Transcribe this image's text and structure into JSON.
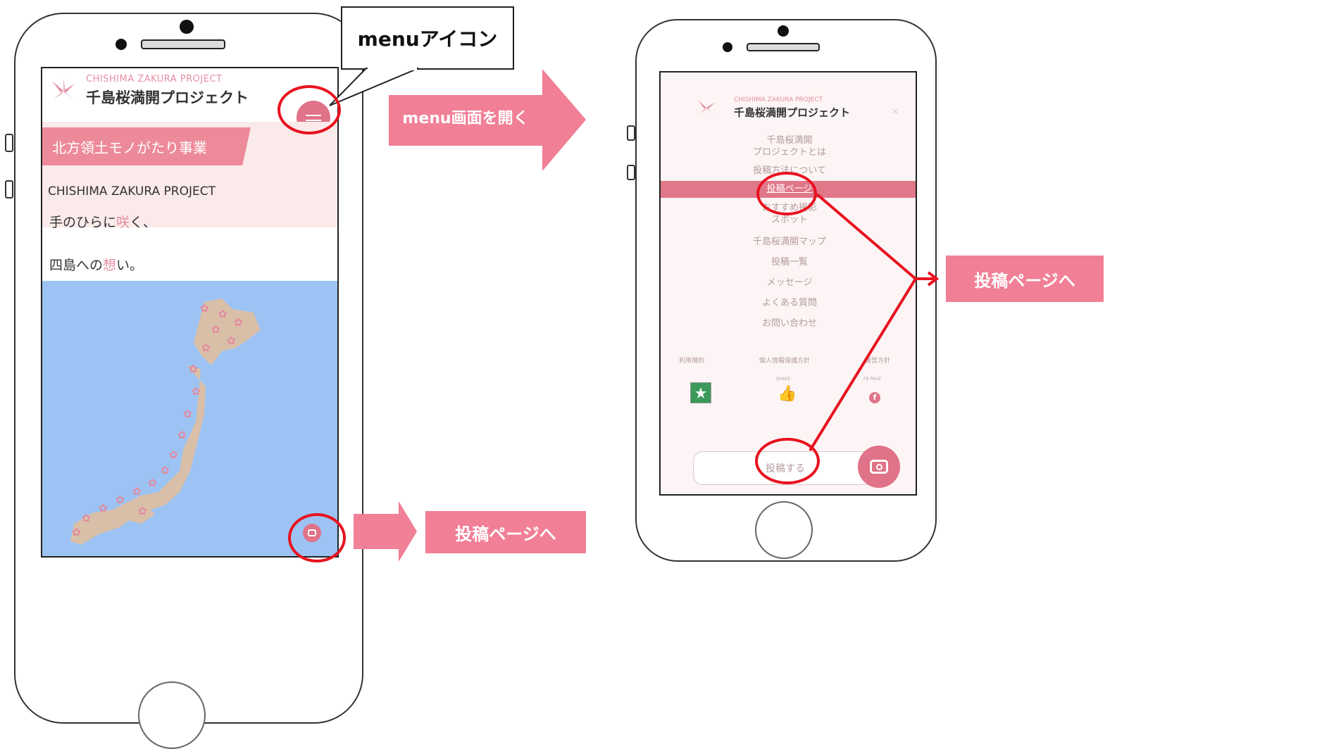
{
  "left_screen": {
    "project_en": "CHISHIMA ZAKURA PROJECT",
    "project_jp": "千島桜満開プロジェクト",
    "banner": "北方領土モノがたり事業",
    "subtitle": "CHISHIMA ZAKURA PROJECT",
    "tagline_1a": "手のひらに",
    "tagline_1b": "咲",
    "tagline_1c": "く、",
    "tagline_2a": "四島への",
    "tagline_2b": "想",
    "tagline_2c": "い。"
  },
  "right_screen": {
    "project_en": "CHISHIMA ZAKURA PROJECT",
    "project_jp": "千島桜満開プロジェクト",
    "close": "×",
    "menu_items": [
      "千島桜満開",
      "プロジェクトとは",
      "投稿方法について",
      "投稿ページ",
      "おすすめ撮影",
      "スポット",
      "千島桜満開マップ",
      "投稿一覧",
      "メッセージ",
      "よくある質問",
      "お問い合わせ"
    ],
    "footer_links": [
      "利用規約",
      "個人情報保護方針",
      "運営方針"
    ],
    "share_label": "SHARE",
    "fb_label": "FB PAGE",
    "post_button": "投稿する"
  },
  "annotations": {
    "menu_callout": "menuアイコン",
    "open_menu": "menu画面を開く",
    "to_post_bottom": "投稿ページへ",
    "to_post_right": "投稿ページへ"
  },
  "colors": {
    "accent_pink": "#f17f95",
    "annotation_red": "#e8121f",
    "sea_blue": "#9cc3f3",
    "land": "#d9bfa8"
  },
  "icons": [
    "menu-icon",
    "camera-icon",
    "sakura-logo-icon",
    "like-icon",
    "facebook-icon"
  ]
}
